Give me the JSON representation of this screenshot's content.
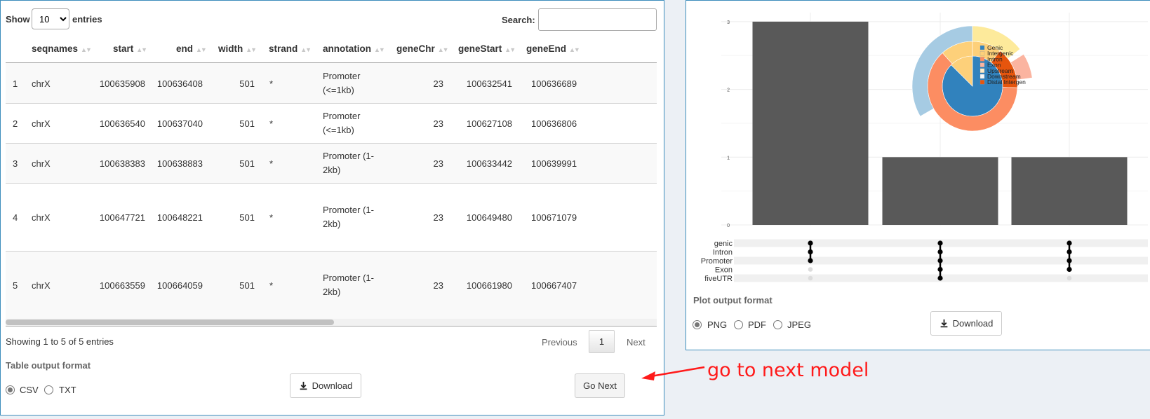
{
  "table_controls": {
    "show_label": "Show",
    "length_value": "10",
    "entries_label": "entries",
    "search_label": "Search:",
    "search_value": ""
  },
  "table": {
    "columns": [
      "",
      "seqnames",
      "start",
      "end",
      "width",
      "strand",
      "annotation",
      "geneChr",
      "geneStart",
      "geneEnd"
    ],
    "rows": [
      {
        "idx": "1",
        "seqnames": "chrX",
        "start": "100635908",
        "end": "100636408",
        "width": "501",
        "strand": "*",
        "annotation": "Promoter (<=1kb)",
        "geneChr": "23",
        "geneStart": "100632541",
        "geneEnd": "100636689"
      },
      {
        "idx": "2",
        "seqnames": "chrX",
        "start": "100636540",
        "end": "100637040",
        "width": "501",
        "strand": "*",
        "annotation": "Promoter (<=1kb)",
        "geneChr": "23",
        "geneStart": "100627108",
        "geneEnd": "100636806"
      },
      {
        "idx": "3",
        "seqnames": "chrX",
        "start": "100638383",
        "end": "100638883",
        "width": "501",
        "strand": "*",
        "annotation": "Promoter (1-2kb)",
        "geneChr": "23",
        "geneStart": "100633442",
        "geneEnd": "100639991"
      },
      {
        "idx": "4",
        "seqnames": "chrX",
        "start": "100647721",
        "end": "100648221",
        "width": "501",
        "strand": "*",
        "annotation": "Promoter (1-2kb)",
        "geneChr": "23",
        "geneStart": "100649480",
        "geneEnd": "100671079"
      },
      {
        "idx": "5",
        "seqnames": "chrX",
        "start": "100663559",
        "end": "100664059",
        "width": "501",
        "strand": "*",
        "annotation": "Promoter (1-2kb)",
        "geneChr": "23",
        "geneStart": "100661980",
        "geneEnd": "100667407"
      }
    ]
  },
  "table_footer": {
    "info": "Showing 1 to 5 of 5 entries",
    "previous": "Previous",
    "page": "1",
    "next": "Next"
  },
  "table_output": {
    "label": "Table output format",
    "options": [
      "CSV",
      "TXT"
    ],
    "selected": "CSV",
    "download": "Download",
    "go_next": "Go Next"
  },
  "annotation": {
    "text": "go to next model",
    "color": "#ff1a1a"
  },
  "chart_data": {
    "type": "bar",
    "categories": [
      "genic+Intron+Promoter",
      "genic+Intron+Promoter+Exon+fiveUTR",
      "genic+Intron+Promoter+Exon"
    ],
    "values": [
      3,
      1,
      1
    ],
    "yticks": [
      "0",
      "1",
      "2",
      "3"
    ],
    "ylim": [
      0,
      3.1
    ],
    "bar_color": "#595959",
    "sets": [
      "genic",
      "Intron",
      "Promoter",
      "Exon",
      "fiveUTR"
    ],
    "membership": [
      [
        1,
        1,
        1,
        0,
        0
      ],
      [
        1,
        1,
        1,
        1,
        1
      ],
      [
        1,
        1,
        1,
        1,
        0
      ]
    ],
    "legend": [
      {
        "label": "Genic",
        "color": "#3182bd"
      },
      {
        "label": "Intergenic",
        "color": "#fdd07a"
      },
      {
        "label": "Intron",
        "color": "#fc8d62"
      },
      {
        "label": "Exon",
        "color": "#fbb4a0"
      },
      {
        "label": "Upstream",
        "color": "#fdebc8"
      },
      {
        "label": "Downstream",
        "color": "#f7f7f7"
      },
      {
        "label": "Distal Intergen",
        "color": "#e6550d"
      }
    ]
  },
  "plot_output": {
    "label": "Plot output format",
    "options": [
      "PNG",
      "PDF",
      "JPEG"
    ],
    "selected": "PNG",
    "download": "Download"
  }
}
